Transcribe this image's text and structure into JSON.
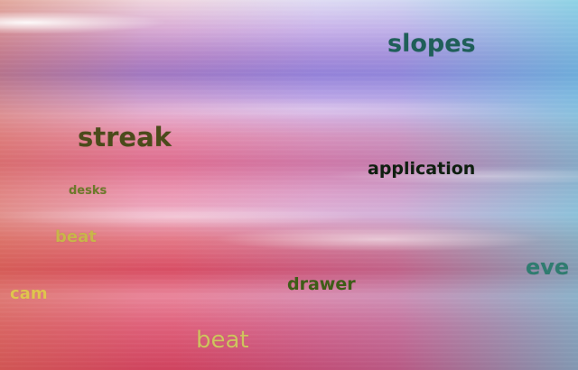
{
  "words": [
    {
      "text": "slopes",
      "color": "#1f5f59"
    },
    {
      "text": "streak",
      "color": "#4b4b1b"
    },
    {
      "text": "application",
      "color": "#0f1f10"
    },
    {
      "text": "desks",
      "color": "#6d7a2a"
    },
    {
      "text": "beat",
      "color": "#c9b54a"
    },
    {
      "text": "eve",
      "color": "#2f7c70"
    },
    {
      "text": "cam",
      "color": "#e0c44e"
    },
    {
      "text": "drawer",
      "color": "#3e5d17"
    },
    {
      "text": "beat",
      "color": "#cfc35e"
    }
  ]
}
